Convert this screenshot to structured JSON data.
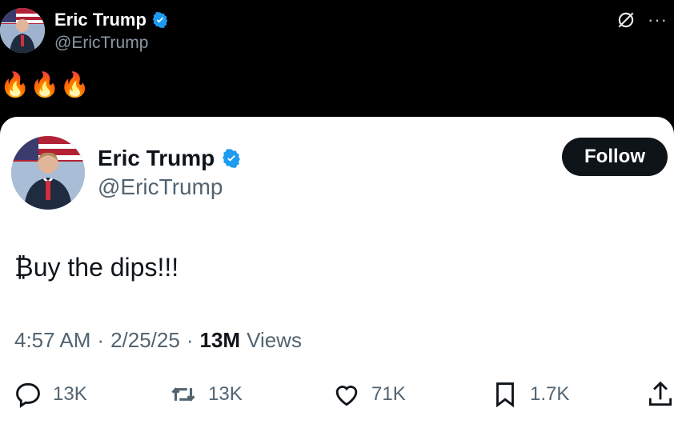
{
  "header": {
    "name": "Eric Trump",
    "handle": "@EricTrump"
  },
  "reply": {
    "text": "🔥🔥🔥"
  },
  "quoted": {
    "name": "Eric Trump",
    "handle": "@EricTrump",
    "follow_label": "Follow",
    "body": "₿uy the dips!!!",
    "time": "4:57 AM",
    "date": "2/25/25",
    "views_count": "13M",
    "views_label": "Views",
    "separator": "·"
  },
  "actions": {
    "reply_count": "13K",
    "repost_count": "13K",
    "like_count": "71K",
    "bookmark_count": "1.7K"
  },
  "colors": {
    "verified": "#1d9bf0",
    "dark_bg": "#000000",
    "card_bg": "#ffffff",
    "muted": "#536471"
  },
  "icons": [
    "verified-badge-icon",
    "grok-icon",
    "more-icon",
    "reply-icon",
    "repost-icon",
    "like-icon",
    "bookmark-icon",
    "share-icon"
  ]
}
